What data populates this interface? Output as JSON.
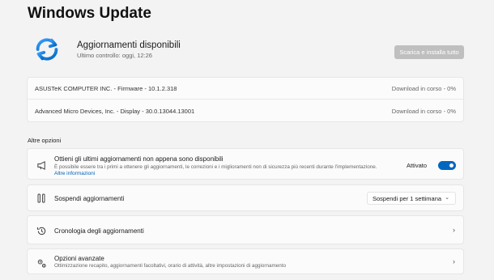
{
  "page": {
    "title": "Windows Update"
  },
  "status": {
    "title": "Aggiornamenti disponibili",
    "subtitle": "Ultimo controllo: oggi, 12:26",
    "action_label": "Scarica e installa tutto"
  },
  "updates": [
    {
      "name": "ASUSTeK COMPUTER INC. - Firmware - 10.1.2.318",
      "status": "Download in corso - 0%"
    },
    {
      "name": "Advanced Micro Devices, Inc. - Display - 30.0.13044.13001",
      "status": "Download in corso - 0%"
    }
  ],
  "more_options": {
    "label": "Altre opzioni",
    "latest": {
      "title": "Ottieni gli ultimi aggiornamenti non appena sono disponibili",
      "subtitle": "È possibile essere tra i primi a ottenere gli aggiornamenti, le correzioni e i miglioramenti non di sicurezza più recenti durante l'implementazione.",
      "link": "Altre informazioni",
      "toggle_label": "Attivato",
      "toggle_on": true
    },
    "pause": {
      "title": "Sospendi aggiornamenti",
      "selected": "Sospendi per 1 settimana"
    },
    "history": {
      "title": "Cronologia degli aggiornamenti"
    },
    "advanced": {
      "title": "Opzioni avanzate",
      "subtitle": "Ottimizzazione recapito, aggiornamenti facoltativi, orario di attività, altre impostazioni di aggiornamento"
    }
  },
  "colors": {
    "accent": "#0067c0",
    "link": "#005fb8"
  }
}
